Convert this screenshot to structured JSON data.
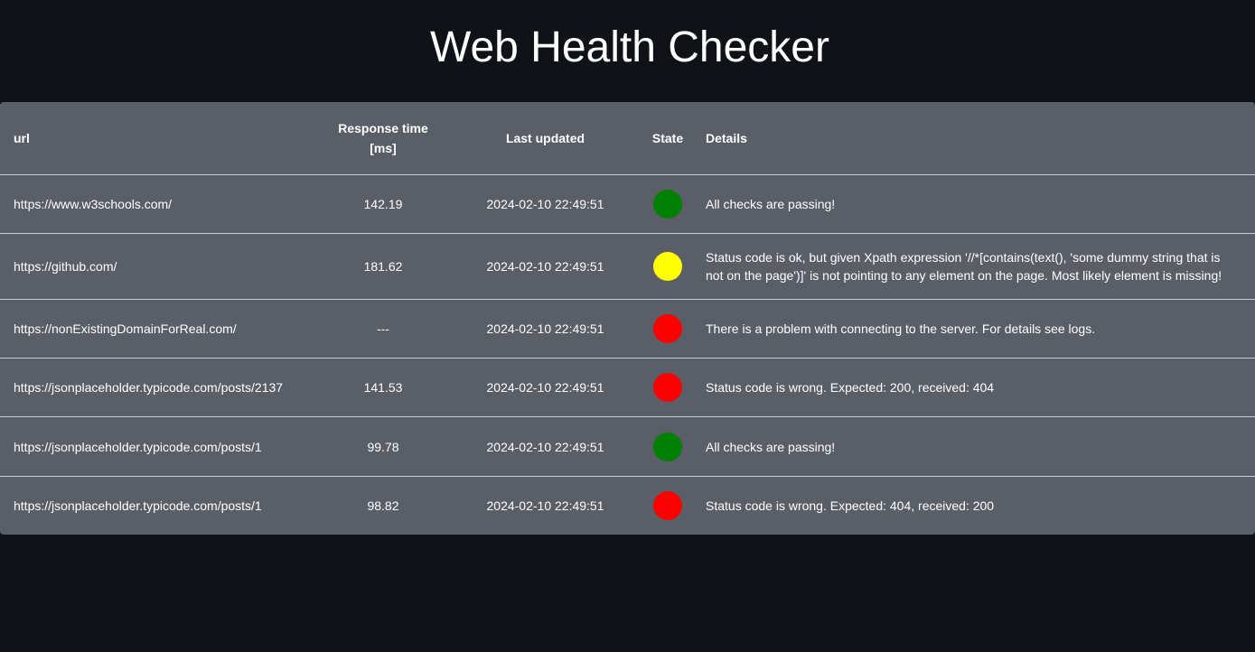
{
  "title": "Web Health Checker",
  "table": {
    "headers": {
      "url": "url",
      "response_time_line1": "Response time",
      "response_time_line2": "[ms]",
      "last_updated": "Last updated",
      "state": "State",
      "details": "Details"
    },
    "rows": [
      {
        "url": "https://www.w3schools.com/",
        "response_time": "142.19",
        "last_updated": "2024-02-10 22:49:51",
        "state": "green",
        "state_color": "#008000",
        "details": "All checks are passing!"
      },
      {
        "url": "https://github.com/",
        "response_time": "181.62",
        "last_updated": "2024-02-10 22:49:51",
        "state": "yellow",
        "state_color": "#ffff00",
        "details": "Status code is ok, but given Xpath expression '//*[contains(text(), 'some dummy string that is not on the page')]' is not pointing to any element on the page. Most likely element is missing!"
      },
      {
        "url": "https://nonExistingDomainForReal.com/",
        "response_time": "---",
        "last_updated": "2024-02-10 22:49:51",
        "state": "red",
        "state_color": "#ff0000",
        "details": "There is a problem with connecting to the server. For details see logs."
      },
      {
        "url": "https://jsonplaceholder.typicode.com/posts/2137",
        "response_time": "141.53",
        "last_updated": "2024-02-10 22:49:51",
        "state": "red",
        "state_color": "#ff0000",
        "details": "Status code is wrong. Expected: 200, received: 404"
      },
      {
        "url": "https://jsonplaceholder.typicode.com/posts/1",
        "response_time": "99.78",
        "last_updated": "2024-02-10 22:49:51",
        "state": "green",
        "state_color": "#008000",
        "details": "All checks are passing!"
      },
      {
        "url": "https://jsonplaceholder.typicode.com/posts/1",
        "response_time": "98.82",
        "last_updated": "2024-02-10 22:49:51",
        "state": "red",
        "state_color": "#ff0000",
        "details": "Status code is wrong. Expected: 404, received: 200"
      }
    ]
  }
}
